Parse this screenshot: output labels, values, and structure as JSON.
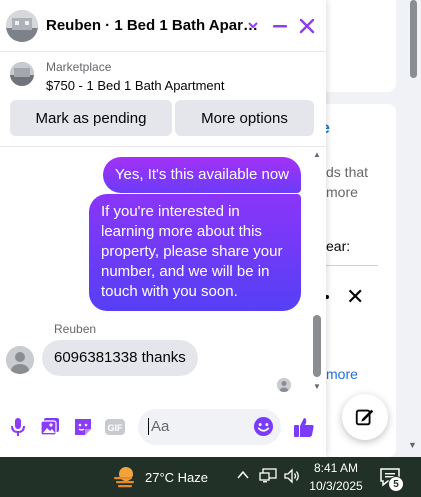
{
  "background": {
    "text_line_1": "ds that",
    "text_line_2": "more",
    "text_line_3": "ear:",
    "link": "more"
  },
  "chat": {
    "title": "Reuben · 1 Bed 1 Bath Apar…",
    "listing": {
      "source": "Marketplace",
      "title": "$750 - 1 Bed 1 Bath Apartment",
      "mark_pending_label": "Mark as pending",
      "more_options_label": "More options"
    },
    "messages": [
      {
        "direction": "outgoing",
        "text": "Yes, It's this available now"
      },
      {
        "direction": "outgoing",
        "text": "If you're interested in learning more about this property, please share your number, and we will be in touch with you soon."
      },
      {
        "direction": "incoming",
        "sender": "Reuben",
        "text": "6096381338 thanks"
      }
    ],
    "composer": {
      "placeholder": "Aa",
      "gif_label": "GIF"
    },
    "accent_color": "#7a3cf7",
    "icons": [
      "chevron-down-icon",
      "minimize-icon",
      "close-icon",
      "microphone-icon",
      "photo-icon",
      "sticker-icon",
      "gif-icon",
      "emoji-icon",
      "thumbs-up-icon",
      "compose-icon"
    ]
  },
  "taskbar": {
    "weather": "27°C  Haze",
    "time": "8:41 AM",
    "date": "10/3/2025",
    "notification_count": "5",
    "background_color": "#213127"
  }
}
